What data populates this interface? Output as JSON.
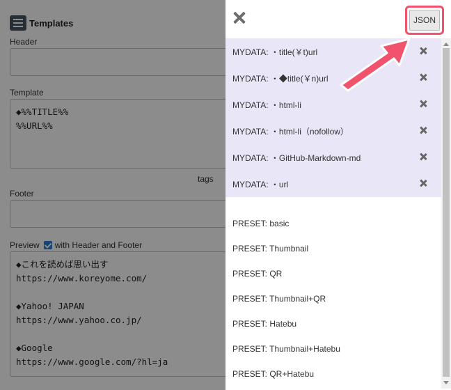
{
  "background": {
    "title": "Templates",
    "header_label": "Header",
    "template_label": "Template",
    "template_text": "◆%%TITLE%%\n%%URL%%",
    "tags_label": "tags",
    "footer_label": "Footer",
    "preview_label": "Preview",
    "with_header_footer_label": "with Header and Footer",
    "preview_text": "◆これを読めば思い出す\nhttps://www.koreyome.com/\n\n◆Yahoo! JAPAN\nhttps://www.yahoo.co.jp/\n\n◆Google\nhttps://www.google.com/?hl=ja"
  },
  "panel": {
    "json_button_label": "JSON",
    "mydata_items": [
      "MYDATA: ・title(￥t)url",
      "MYDATA: ・◆title(￥n)url",
      "MYDATA: ・html-li",
      "MYDATA: ・html-li（nofollow）",
      "MYDATA: ・GitHub-Markdown-md",
      "MYDATA: ・url"
    ],
    "preset_items": [
      "PRESET: basic",
      "PRESET: Thumbnail",
      "PRESET: QR",
      "PRESET: Thumbnail+QR",
      "PRESET: Hatebu",
      "PRESET: Thumbnail+Hatebu",
      "PRESET: QR+Hatebu"
    ]
  },
  "colors": {
    "mydata_bg": "#e8e6f7",
    "highlight": "#f0536b",
    "overlay": "rgba(0,0,0,0.45)"
  }
}
